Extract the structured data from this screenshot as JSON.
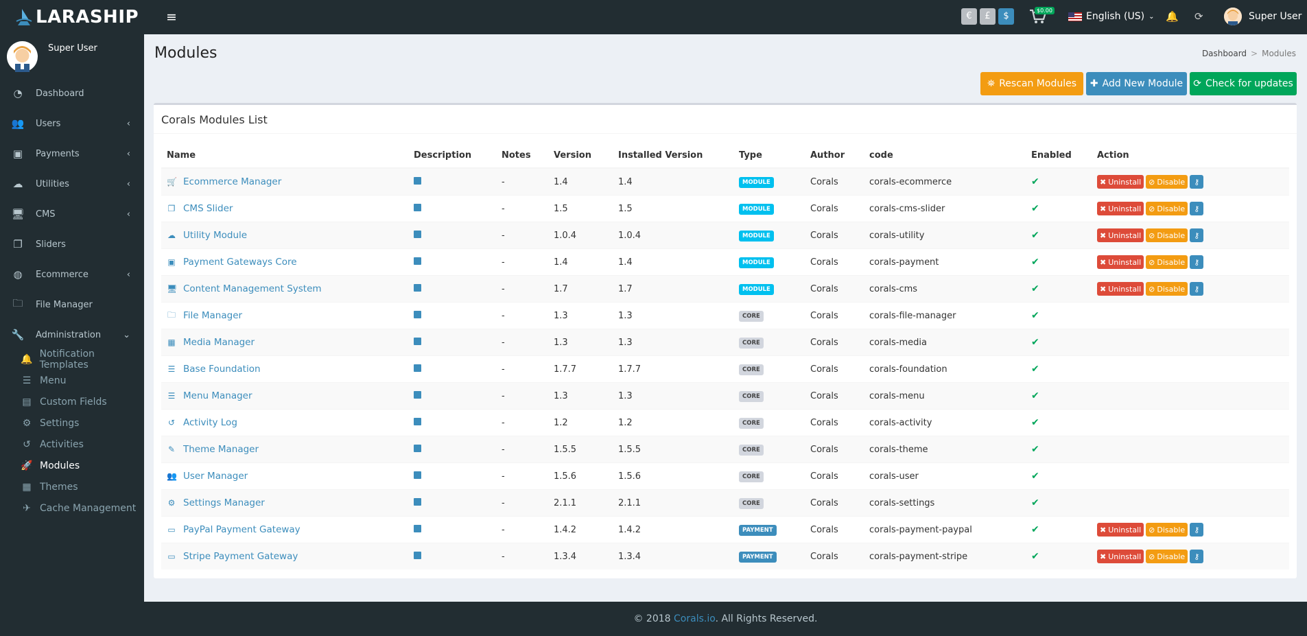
{
  "app": {
    "name": "LARASHIP",
    "menu_toggle": "≡"
  },
  "topbar": {
    "currencies": [
      {
        "symbol": "€",
        "color": "#b9bdc2"
      },
      {
        "symbol": "£",
        "color": "#b9bdc2"
      },
      {
        "symbol": "$",
        "color": "#3c8dbc"
      }
    ],
    "cart_total": "$0.00",
    "language": "English (US)",
    "user_name": "Super User"
  },
  "sidebar": {
    "user_name": "Super User",
    "items": [
      {
        "label": "Dashboard",
        "icon": "dashboard-icon",
        "glyph": "◔",
        "has_children": false
      },
      {
        "label": "Users",
        "icon": "users-icon",
        "glyph": "👥",
        "has_children": true
      },
      {
        "label": "Payments",
        "icon": "money-icon",
        "glyph": "▣",
        "has_children": true
      },
      {
        "label": "Utilities",
        "icon": "cloud-icon",
        "glyph": "☁",
        "has_children": true
      },
      {
        "label": "CMS",
        "icon": "desktop-icon",
        "glyph": "🖥",
        "has_children": true
      },
      {
        "label": "Sliders",
        "icon": "clone-icon",
        "glyph": "❐",
        "has_children": false
      },
      {
        "label": "Ecommerce",
        "icon": "globe-icon",
        "glyph": "◍",
        "has_children": true
      },
      {
        "label": "File Manager",
        "icon": "folder-icon",
        "glyph": "🗀",
        "has_children": false
      },
      {
        "label": "Administration",
        "icon": "wrench-icon",
        "glyph": "🔧",
        "has_children": true,
        "expanded": true
      }
    ],
    "admin_items": [
      {
        "label": "Notification Templates",
        "icon": "bell-icon",
        "glyph": "🔔"
      },
      {
        "label": "Menu",
        "icon": "bars-icon",
        "glyph": "☰"
      },
      {
        "label": "Custom Fields",
        "icon": "file-icon",
        "glyph": "▤"
      },
      {
        "label": "Settings",
        "icon": "cogs-icon",
        "glyph": "⚙"
      },
      {
        "label": "Activities",
        "icon": "history-icon",
        "glyph": "↺"
      },
      {
        "label": "Modules",
        "icon": "rocket-icon",
        "glyph": "🚀",
        "active": true
      },
      {
        "label": "Themes",
        "icon": "image-icon",
        "glyph": "▦"
      },
      {
        "label": "Cache Management",
        "icon": "plane-icon",
        "glyph": "✈"
      }
    ]
  },
  "page": {
    "title": "Modules",
    "breadcrumb": [
      "Dashboard",
      "Modules"
    ],
    "buttons": {
      "rescan": "Rescan Modules",
      "add": "Add New Module",
      "check": "Check for updates"
    }
  },
  "box": {
    "title": "Corals Modules List"
  },
  "table": {
    "headers": [
      "Name",
      "Description",
      "Notes",
      "Version",
      "Installed Version",
      "Type",
      "Author",
      "code",
      "Enabled",
      "Action"
    ],
    "rows": [
      {
        "name": "Ecommerce Manager",
        "icon": "cart-icon",
        "glyph": "🛒",
        "notes": "-",
        "version": "1.4",
        "installed": "1.4",
        "type": "MODULE",
        "author": "Corals",
        "code": "corals-ecommerce",
        "actions": true
      },
      {
        "name": "CMS Slider",
        "icon": "clone-icon",
        "glyph": "❐",
        "notes": "-",
        "version": "1.5",
        "installed": "1.5",
        "type": "MODULE",
        "author": "Corals",
        "code": "corals-cms-slider",
        "actions": true
      },
      {
        "name": "Utility Module",
        "icon": "cloud-icon",
        "glyph": "☁",
        "notes": "-",
        "version": "1.0.4",
        "installed": "1.0.4",
        "type": "MODULE",
        "author": "Corals",
        "code": "corals-utility",
        "actions": true
      },
      {
        "name": "Payment Gateways Core",
        "icon": "money-icon",
        "glyph": "▣",
        "notes": "-",
        "version": "1.4",
        "installed": "1.4",
        "type": "MODULE",
        "author": "Corals",
        "code": "corals-payment",
        "actions": true
      },
      {
        "name": "Content Management System",
        "icon": "desktop-icon",
        "glyph": "🖥",
        "notes": "-",
        "version": "1.7",
        "installed": "1.7",
        "type": "MODULE",
        "author": "Corals",
        "code": "corals-cms",
        "actions": true
      },
      {
        "name": "File Manager",
        "icon": "folder-icon",
        "glyph": "🗀",
        "notes": "-",
        "version": "1.3",
        "installed": "1.3",
        "type": "CORE",
        "author": "Corals",
        "code": "corals-file-manager",
        "actions": false
      },
      {
        "name": "Media Manager",
        "icon": "image-icon",
        "glyph": "▦",
        "notes": "-",
        "version": "1.3",
        "installed": "1.3",
        "type": "CORE",
        "author": "Corals",
        "code": "corals-media",
        "actions": false
      },
      {
        "name": "Base Foundation",
        "icon": "bars-icon",
        "glyph": "☰",
        "notes": "-",
        "version": "1.7.7",
        "installed": "1.7.7",
        "type": "CORE",
        "author": "Corals",
        "code": "corals-foundation",
        "actions": false
      },
      {
        "name": "Menu Manager",
        "icon": "bars-icon",
        "glyph": "☰",
        "notes": "-",
        "version": "1.3",
        "installed": "1.3",
        "type": "CORE",
        "author": "Corals",
        "code": "corals-menu",
        "actions": false
      },
      {
        "name": "Activity Log",
        "icon": "history-icon",
        "glyph": "↺",
        "notes": "-",
        "version": "1.2",
        "installed": "1.2",
        "type": "CORE",
        "author": "Corals",
        "code": "corals-activity",
        "actions": false
      },
      {
        "name": "Theme Manager",
        "icon": "magic-icon",
        "glyph": "✎",
        "notes": "-",
        "version": "1.5.5",
        "installed": "1.5.5",
        "type": "CORE",
        "author": "Corals",
        "code": "corals-theme",
        "actions": false
      },
      {
        "name": "User Manager",
        "icon": "users-icon",
        "glyph": "👥",
        "notes": "-",
        "version": "1.5.6",
        "installed": "1.5.6",
        "type": "CORE",
        "author": "Corals",
        "code": "corals-user",
        "actions": false
      },
      {
        "name": "Settings Manager",
        "icon": "cogs-icon",
        "glyph": "⚙",
        "notes": "-",
        "version": "2.1.1",
        "installed": "2.1.1",
        "type": "CORE",
        "author": "Corals",
        "code": "corals-settings",
        "actions": false
      },
      {
        "name": "PayPal Payment Gateway",
        "icon": "paypal-icon",
        "glyph": "▭",
        "notes": "-",
        "version": "1.4.2",
        "installed": "1.4.2",
        "type": "PAYMENT",
        "author": "Corals",
        "code": "corals-payment-paypal",
        "actions": true
      },
      {
        "name": "Stripe Payment Gateway",
        "icon": "stripe-icon",
        "glyph": "▭",
        "notes": "-",
        "version": "1.3.4",
        "installed": "1.3.4",
        "type": "PAYMENT",
        "author": "Corals",
        "code": "corals-payment-stripe",
        "actions": true
      }
    ],
    "action_labels": {
      "uninstall": "Uninstall",
      "disable": "Disable"
    },
    "type_colors": {
      "MODULE": "#00c0ef",
      "CORE": "#d2d6de",
      "PAYMENT": "#3c8dbc"
    },
    "type_text_colors": {
      "MODULE": "#ffffff",
      "CORE": "#444444",
      "PAYMENT": "#ffffff"
    }
  },
  "footer": {
    "prefix": "© 2018",
    "link": "Corals.io",
    "suffix": ". All Rights Reserved."
  },
  "colors": {
    "primary": "#3c8dbc",
    "success": "#00a65a",
    "warning": "#f39c12",
    "danger": "#dd4b39",
    "sidebar": "#222d32"
  }
}
